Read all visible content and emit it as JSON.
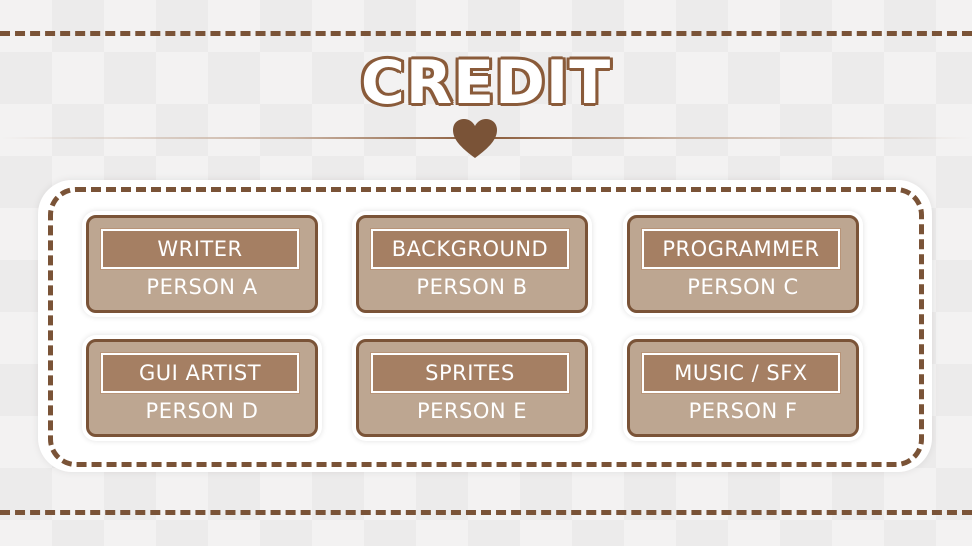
{
  "screen": {
    "title": "CREDIT"
  },
  "colors": {
    "accent_brown": "#7a5337",
    "card_fill": "#bda691",
    "role_fill": "#a57f63",
    "text_light": "#ffffff"
  },
  "icons": {
    "divider_ornament": "heart-icon"
  },
  "credits": [
    {
      "role": "WRITER",
      "person": "PERSON A"
    },
    {
      "role": "BACKGROUND",
      "person": "PERSON B"
    },
    {
      "role": "PROGRAMMER",
      "person": "PERSON C"
    },
    {
      "role": "GUI ARTIST",
      "person": "PERSON D"
    },
    {
      "role": "SPRITES",
      "person": "PERSON E"
    },
    {
      "role": "MUSIC / SFX",
      "person": "PERSON F"
    }
  ]
}
